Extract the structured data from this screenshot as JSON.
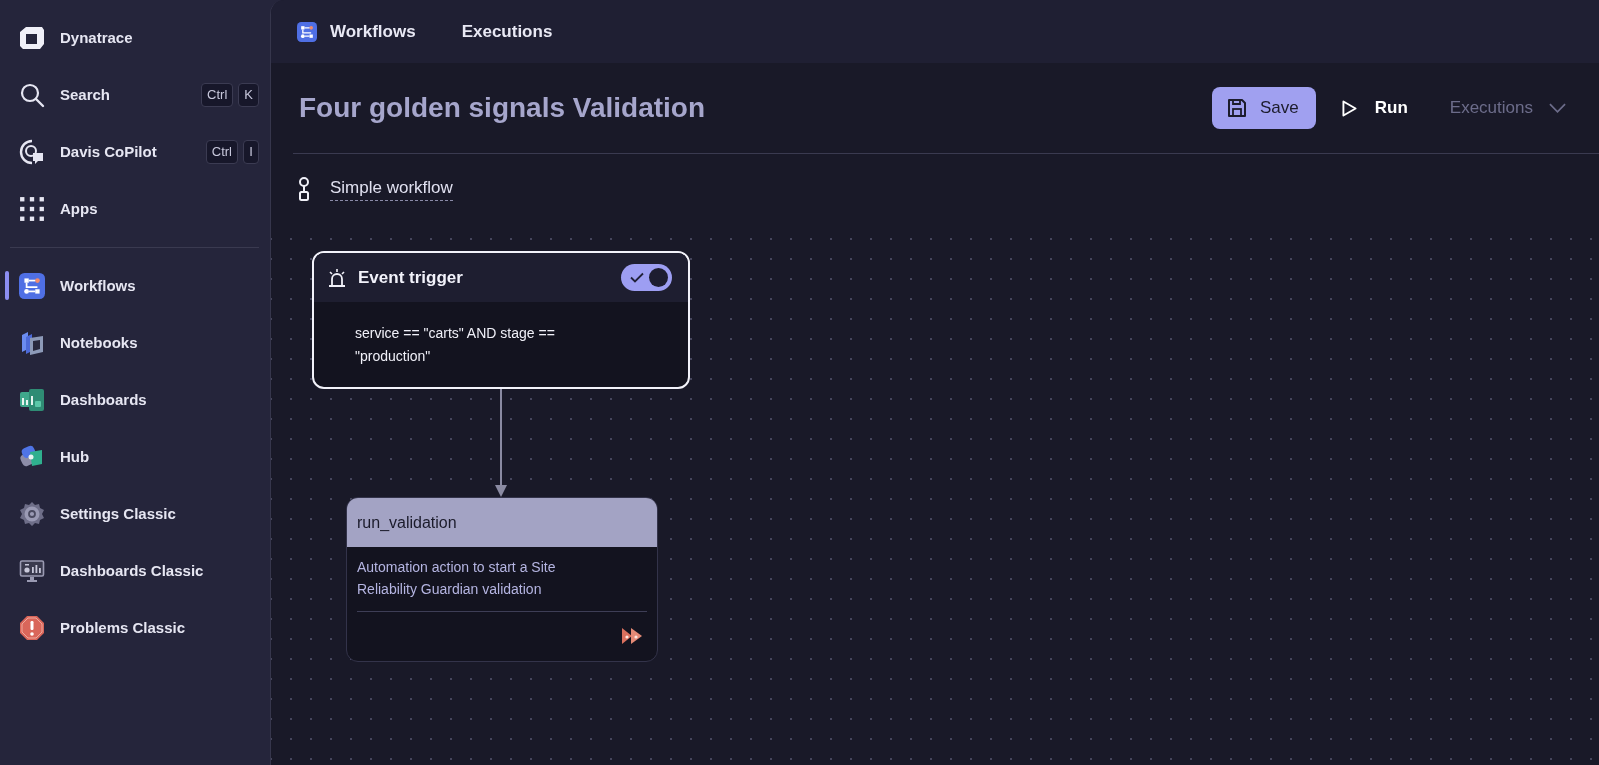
{
  "sidebar": {
    "brand": {
      "label": "Dynatrace"
    },
    "tools": [
      {
        "label": "Search",
        "keys": [
          "Ctrl",
          "K"
        ]
      },
      {
        "label": "Davis CoPilot",
        "keys": [
          "Ctrl",
          "I"
        ]
      },
      {
        "label": "Apps"
      }
    ],
    "apps": [
      {
        "label": "Workflows",
        "selected": true
      },
      {
        "label": "Notebooks",
        "selected": false
      },
      {
        "label": "Dashboards",
        "selected": false
      },
      {
        "label": "Hub",
        "selected": false
      },
      {
        "label": "Settings Classic",
        "selected": false
      },
      {
        "label": "Dashboards Classic",
        "selected": false
      },
      {
        "label": "Problems Classic",
        "selected": false
      }
    ]
  },
  "app_bar": {
    "app_name": "Workflows",
    "links": [
      {
        "label": "Executions"
      }
    ]
  },
  "page": {
    "title": "Four golden signals Validation",
    "actions": [
      {
        "kind": "primary",
        "label": "Save",
        "disabled": false
      },
      {
        "kind": "run",
        "label": "Run",
        "disabled": false
      },
      {
        "kind": "dropdown",
        "label": "Executions",
        "disabled": true
      }
    ],
    "workflow_type": "Simple workflow"
  },
  "canvas": {
    "nodes": [
      {
        "kind": "trigger",
        "title": "Event trigger",
        "selected": true,
        "on": true,
        "body": "service == \"carts\" AND stage == \"production\""
      },
      {
        "kind": "task",
        "title": "run_validation",
        "selected": false,
        "body": "Automation action to start a Site Reliability Guardian validation"
      }
    ]
  }
}
